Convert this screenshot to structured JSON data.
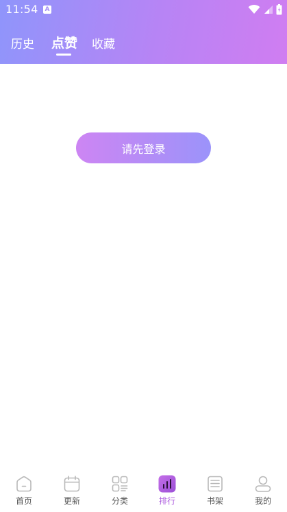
{
  "status_bar": {
    "time": "11:54",
    "notification_badge": "A"
  },
  "header": {
    "tabs": [
      {
        "label": "历史",
        "active": false
      },
      {
        "label": "点赞",
        "active": true
      },
      {
        "label": "收藏",
        "active": false
      }
    ]
  },
  "main": {
    "login_button_label": "请先登录"
  },
  "bottom_nav": {
    "items": [
      {
        "label": "首页",
        "icon": "home-icon",
        "active": false
      },
      {
        "label": "更新",
        "icon": "calendar-icon",
        "active": false
      },
      {
        "label": "分类",
        "icon": "category-grid-icon",
        "active": false
      },
      {
        "label": "排行",
        "icon": "ranking-chart-icon",
        "active": true
      },
      {
        "label": "书架",
        "icon": "bookshelf-icon",
        "active": false
      },
      {
        "label": "我的",
        "icon": "profile-icon",
        "active": false
      }
    ]
  },
  "colors": {
    "accent": "#b062e0",
    "header_gradient_start": "#8f95fb",
    "header_gradient_end": "#d07df1",
    "inactive_icon": "#b8b8b8"
  }
}
